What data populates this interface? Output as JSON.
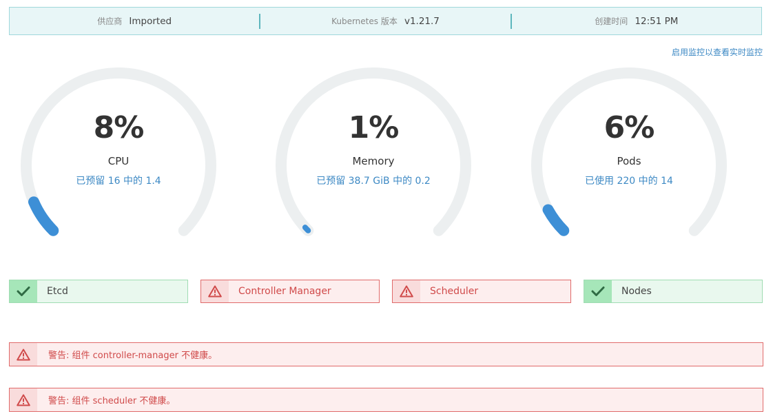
{
  "info_bar": {
    "provider_label": "供应商",
    "provider_value": "Imported",
    "k8s_label": "Kubernetes 版本",
    "k8s_value": "v1.21.7",
    "created_label": "创建时间",
    "created_value": "12:51 PM"
  },
  "monitoring_link": "启用监控以查看实时监控",
  "gauges": [
    {
      "percent": "8%",
      "percent_value": 0.08,
      "name": "CPU",
      "detail": "已预留 16 中的 1.4",
      "arc_color": "#3d8fd6"
    },
    {
      "percent": "1%",
      "percent_value": 0.01,
      "name": "Memory",
      "detail": "已预留 38.7 GiB 中的 0.2",
      "arc_color": "#3d8fd6"
    },
    {
      "percent": "6%",
      "percent_value": 0.06,
      "name": "Pods",
      "detail": "已使用 220 中的 14",
      "arc_color": "#3d8fd6"
    }
  ],
  "components": [
    {
      "label": "Etcd",
      "status": "ok",
      "icon": "check-icon"
    },
    {
      "label": "Controller Manager",
      "status": "error",
      "icon": "warning-icon"
    },
    {
      "label": "Scheduler",
      "status": "error",
      "icon": "warning-icon"
    },
    {
      "label": "Nodes",
      "status": "ok",
      "icon": "check-icon"
    }
  ],
  "alerts": [
    {
      "message": "警告: 组件 controller-manager 不健康。",
      "icon": "warning-icon"
    },
    {
      "message": "警告: 组件 scheduler 不健康。",
      "icon": "warning-icon"
    }
  ],
  "colors": {
    "ok": "#a6e6b9",
    "error": "#e06a6a",
    "accent": "#3d89c4",
    "track": "#eceff0"
  }
}
